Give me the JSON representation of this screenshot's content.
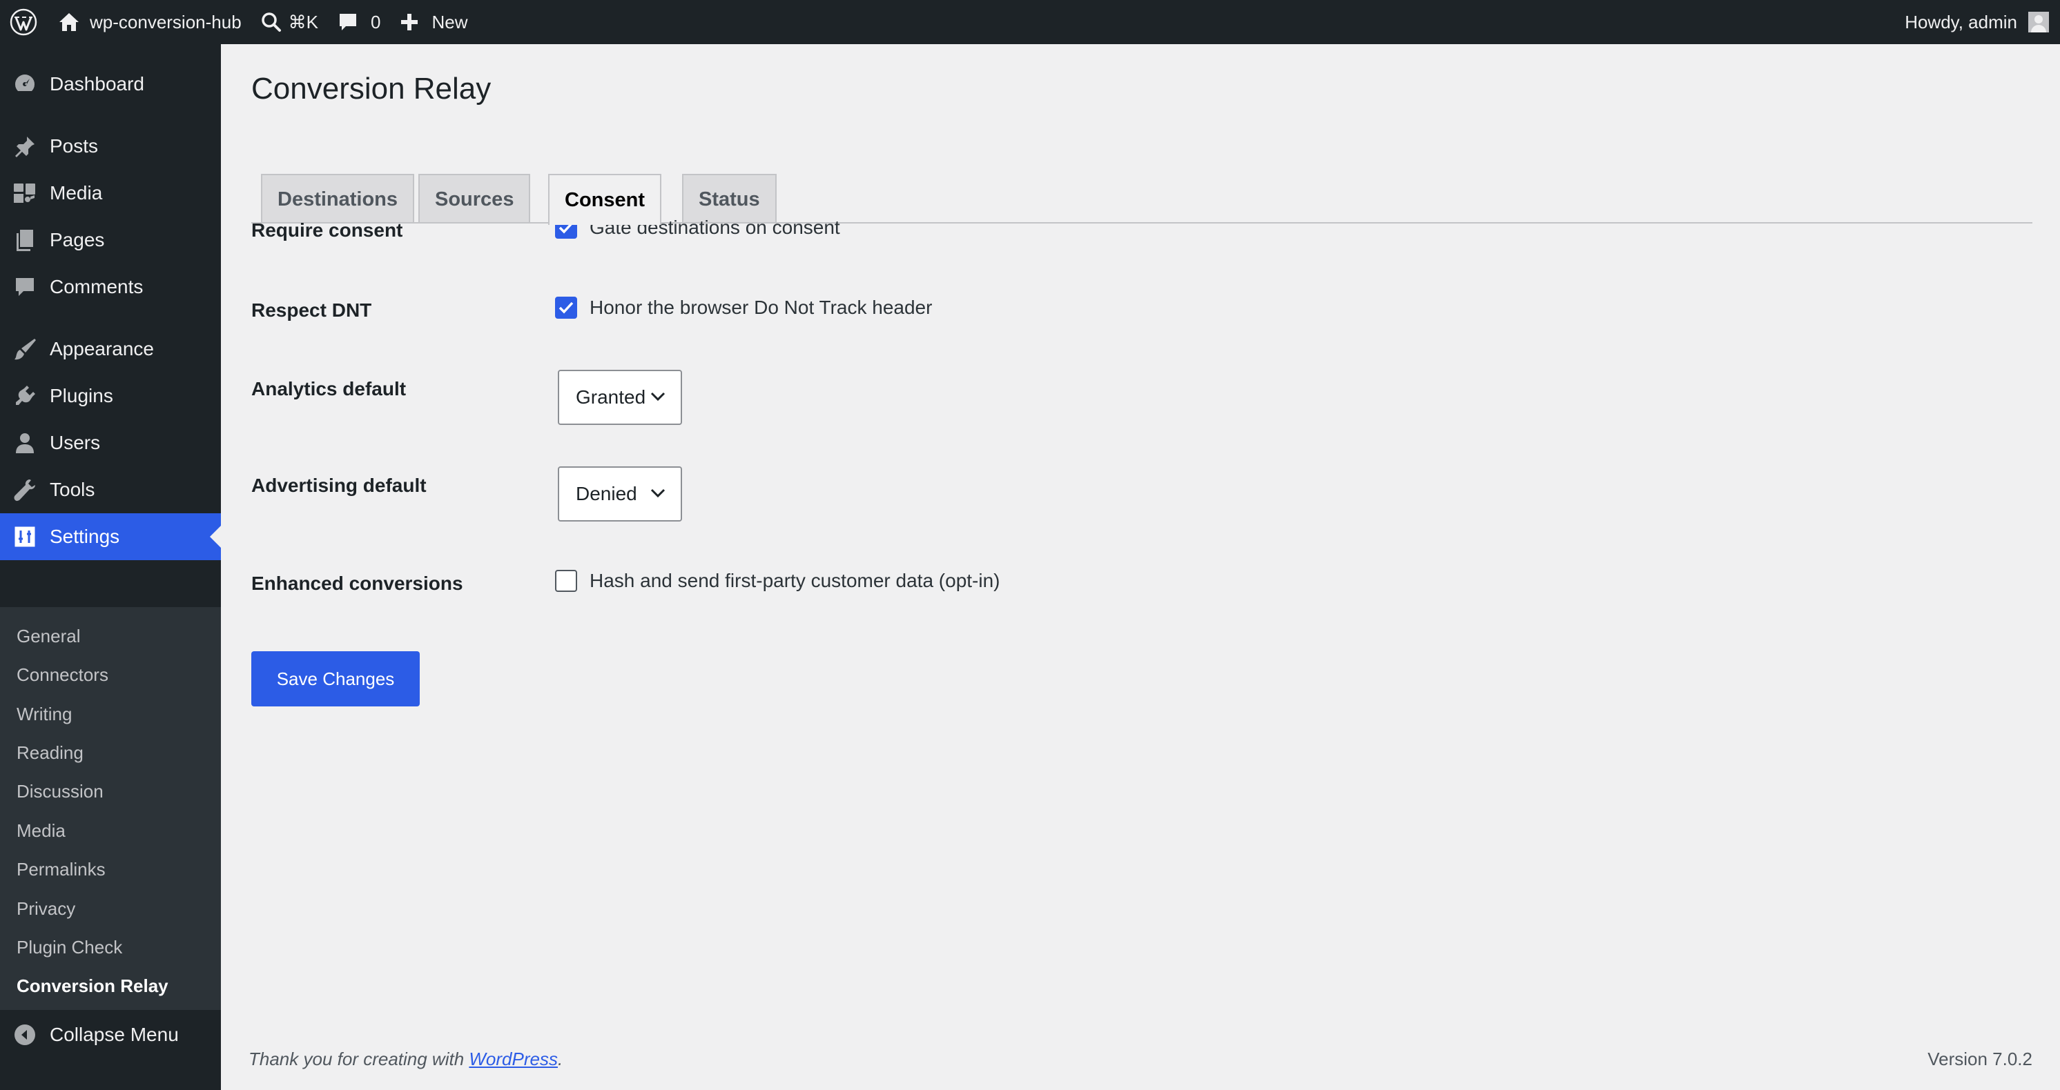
{
  "adminbar": {
    "site_name": "wp-conversion-hub",
    "search_shortcut": "⌘K",
    "comments_count": "0",
    "new_label": "New",
    "greeting": "Howdy, admin"
  },
  "sidebar": {
    "items": [
      {
        "label": "Dashboard",
        "icon": "dashboard-icon"
      },
      {
        "label": "Posts",
        "icon": "pin-icon"
      },
      {
        "label": "Media",
        "icon": "media-icon"
      },
      {
        "label": "Pages",
        "icon": "pages-icon"
      },
      {
        "label": "Comments",
        "icon": "comment-icon"
      },
      {
        "label": "Appearance",
        "icon": "brush-icon"
      },
      {
        "label": "Plugins",
        "icon": "plugin-icon"
      },
      {
        "label": "Users",
        "icon": "user-icon"
      },
      {
        "label": "Tools",
        "icon": "wrench-icon"
      },
      {
        "label": "Settings",
        "icon": "settings-icon",
        "active": true
      }
    ],
    "submenu": [
      "General",
      "Connectors",
      "Writing",
      "Reading",
      "Discussion",
      "Media",
      "Permalinks",
      "Privacy",
      "Plugin Check",
      "Conversion Relay"
    ],
    "current_submenu": "Conversion Relay",
    "collapse_label": "Collapse Menu"
  },
  "page": {
    "title": "Conversion Relay",
    "tabs": [
      "Destinations",
      "Sources",
      "Consent",
      "Status"
    ],
    "active_tab": "Consent"
  },
  "form": {
    "require_consent": {
      "label": "Require consent",
      "checkbox_label": "Gate destinations on consent",
      "checked": true
    },
    "respect_dnt": {
      "label": "Respect DNT",
      "checkbox_label": "Honor the browser Do Not Track header",
      "checked": true
    },
    "analytics_default": {
      "label": "Analytics default",
      "value": "Granted"
    },
    "advertising_default": {
      "label": "Advertising default",
      "value": "Denied"
    },
    "enhanced_conversions": {
      "label": "Enhanced conversions",
      "checkbox_label": "Hash and send first-party customer data (opt-in)",
      "checked": false
    },
    "save_label": "Save Changes"
  },
  "footer": {
    "thanks_prefix": "Thank you for creating with ",
    "thanks_link": "WordPress",
    "thanks_suffix": ".",
    "version": "Version 7.0.2"
  },
  "colors": {
    "accent": "#2c5ce6",
    "adminbar_bg": "#1d2327",
    "content_bg": "#f0f0f1"
  }
}
